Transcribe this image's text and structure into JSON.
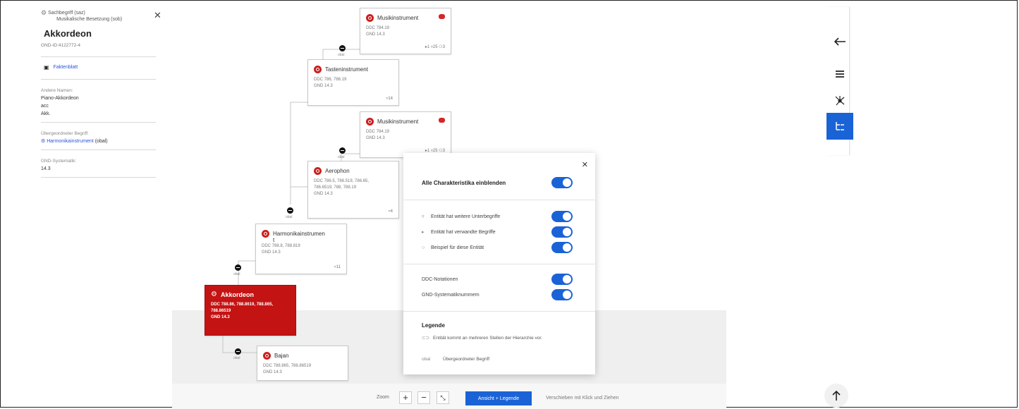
{
  "left_panel": {
    "type_label": "Sachbegriff (saz)",
    "subtype_label": "Musikalische Besetzung (sob)",
    "name": "Akkordeon",
    "gnd_id": "GND-ID:4122772-4",
    "factsheet_link": "Faktenblatt",
    "other_names_label": "Andere Namen:",
    "other_names": [
      "Piano-Akkordeon",
      "acc",
      "Akk."
    ],
    "parent_label": "Übergeordneter Begriff:",
    "parent_value": "Harmonikainstrument",
    "parent_suffix": "(obal)",
    "gnd_system_label": "GND-Systematik:",
    "gnd_system_value": "14.3"
  },
  "nodes": {
    "musik1": {
      "title": "Musikinstrument",
      "ddc": "DDC 784.19",
      "gnd": "GND 14.3",
      "counts": "▸1  ▿25  ⚇3"
    },
    "taste": {
      "title": "Tasteninstrument",
      "ddc": "DDC 786, 786.19",
      "gnd": "GND 14.3",
      "counts": "▿14"
    },
    "musik2": {
      "title": "Musikinstrument",
      "ddc": "DDC 784.19",
      "gnd": "GND 14.3",
      "counts": "▸1  ▿25  ⚇3"
    },
    "aero": {
      "title": "Aerophon",
      "ddc": "DDC 786.5, 786.519, 786.65,",
      "ddc2": "786.6519, 788, 788.19",
      "gnd": "GND 14.3",
      "counts": "▿4"
    },
    "harm": {
      "title": "Harmonikainstrumen",
      "title2": "t",
      "ddc": "DDC 788.8, 788.819",
      "gnd": "GND 14.3",
      "counts": "▿11"
    },
    "akk": {
      "title": "Akkordeon",
      "ddc": "DDC 788.86, 788.8619, 788.865,",
      "ddc2": "788.86519",
      "gnd": "GND 14.3"
    },
    "bajan": {
      "title": "Bajan",
      "ddc": "DDC 788.865, 788.86519",
      "gnd": "GND 14.3"
    }
  },
  "junction_label": "obal",
  "popup": {
    "show_all": "Alle Charakteristika einblenden",
    "opt_sub": "Entität hat weitere Unterbegriffe",
    "opt_related": "Entität hat verwandte Begriffe",
    "opt_example": "Beispiel für diese Entität",
    "opt_ddc": "DDC-Notationen",
    "opt_gnd": "GND-Systematiknummern",
    "legend_title": "Legende",
    "legend_multi": "Entität kommt an mehreren Stellen der Hierarchie vor.",
    "legend_obal_key": "obal",
    "legend_obal": "Übergeordneter Begriff"
  },
  "bottom": {
    "zoom_label": "Zoom",
    "view_button": "Ansicht + Legende",
    "hint": "Verschieben mit Klick und Ziehen"
  },
  "colors": {
    "accent": "#1a63d6",
    "selected": "#c41313",
    "node_dot": "#cc1f1f"
  },
  "icons": [
    "arrow-left-icon",
    "list-icon",
    "network-icon",
    "tree-icon",
    "arrow-up-icon",
    "gear-icon",
    "document-icon"
  ]
}
